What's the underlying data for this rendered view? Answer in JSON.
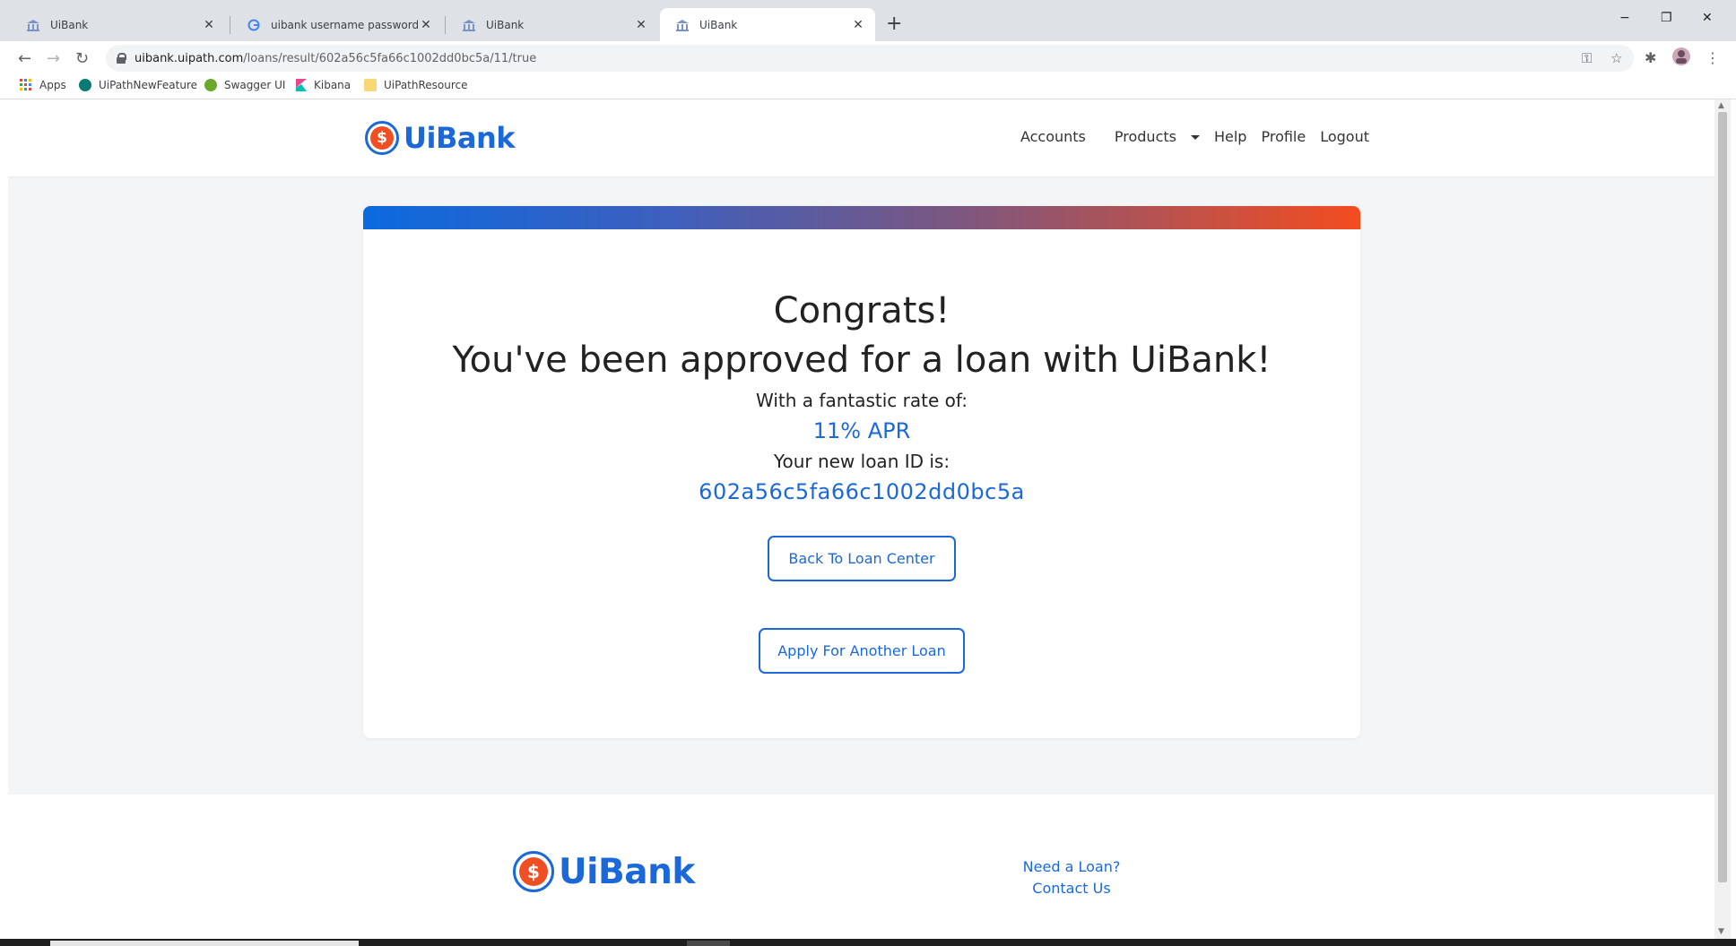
{
  "browser": {
    "tabs": [
      {
        "title": "UiBank",
        "active": false
      },
      {
        "title": "uibank username password - Goo",
        "active": false
      },
      {
        "title": "UiBank",
        "active": false
      },
      {
        "title": "UiBank",
        "active": true
      }
    ],
    "new_tab": "+",
    "window": {
      "minimize": "−",
      "restore": "❐",
      "close": "✕"
    },
    "url_host": "uibank.uipath.com",
    "url_path": "/loans/result/602a56c5fa66c1002dd0bc5a/11/true",
    "bookmarks": [
      {
        "label": "Apps",
        "icon": "apps-grid-icon",
        "color": "#e8453c"
      },
      {
        "label": "UiPathNewFeature",
        "icon": "sharepoint-icon",
        "color": "#0b7a75"
      },
      {
        "label": "Swagger UI",
        "icon": "swagger-icon",
        "color": "#85ea2d"
      },
      {
        "label": "Kibana",
        "icon": "kibana-icon",
        "color": "#e8488b"
      },
      {
        "label": "UiPathResource",
        "icon": "folder-icon",
        "color": "#f8d775"
      }
    ]
  },
  "header": {
    "brand": "UiBank",
    "logo_symbol": "$",
    "nav": {
      "accounts": "Accounts",
      "products": "Products",
      "help": "Help",
      "profile": "Profile",
      "logout": "Logout"
    }
  },
  "result": {
    "congrats": "Congrats!",
    "approved": "You've been approved for a loan with UiBank!",
    "rate_label": "With a fantastic rate of:",
    "rate_value": "11% APR",
    "loan_id_label": "Your new loan ID is:",
    "loan_id": "602a56c5fa66c1002dd0bc5a",
    "back_button": "Back To Loan Center",
    "apply_button": "Apply For Another Loan"
  },
  "footer": {
    "brand": "UiBank",
    "logo_symbol": "$",
    "need_loan": "Need a Loan?",
    "contact": "Contact Us"
  },
  "colors": {
    "brand_blue": "#1b68d8",
    "brand_orange": "#f04e23",
    "page_bg": "#f4f5f7"
  }
}
